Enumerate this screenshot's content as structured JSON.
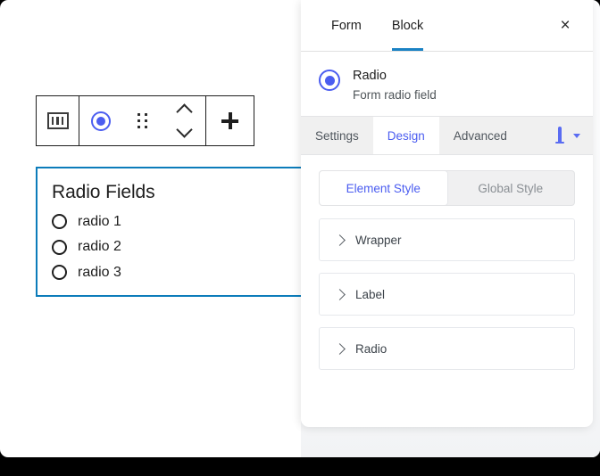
{
  "editor": {
    "toolbar": {
      "form_block_icon": "form-block-icon",
      "radio_icon": "radio-selected-icon",
      "drag_icon": "drag-handle-icon",
      "move_up_icon": "chevron-up-icon",
      "move_down_icon": "chevron-down-icon",
      "add_icon": "plus-icon"
    },
    "block": {
      "title": "Radio Fields",
      "options": [
        {
          "label": "radio 1"
        },
        {
          "label": "radio 2"
        },
        {
          "label": "radio 3"
        }
      ],
      "selection_color": "#0c7cba"
    }
  },
  "inspector": {
    "tabs": [
      {
        "label": "Form",
        "active": false
      },
      {
        "label": "Block",
        "active": true
      }
    ],
    "close_label": "×",
    "active_tab_color": "#1a82c4",
    "identity": {
      "title": "Radio",
      "description": "Form radio field",
      "icon": "radio-selected-icon",
      "icon_color": "#4b5df0"
    },
    "subtabs": [
      {
        "label": "Settings",
        "active": false
      },
      {
        "label": "Design",
        "active": true
      },
      {
        "label": "Advanced",
        "active": false
      }
    ],
    "device_selector": {
      "icon": "desktop-monitor-icon",
      "caret": "chevron-down-icon",
      "color": "#5a6cf2"
    },
    "style_toggle": [
      {
        "label": "Element Style",
        "active": true
      },
      {
        "label": "Global Style",
        "active": false
      }
    ],
    "accordion": [
      {
        "label": "Wrapper"
      },
      {
        "label": "Label"
      },
      {
        "label": "Radio"
      }
    ]
  }
}
